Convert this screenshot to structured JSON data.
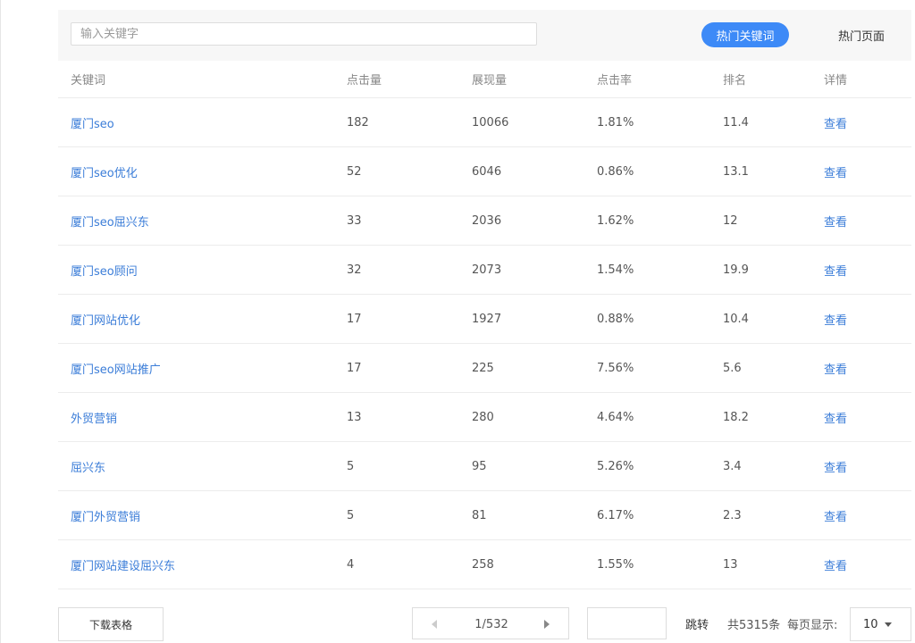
{
  "search": {
    "placeholder": "输入关键字",
    "value": ""
  },
  "tabs": {
    "hot_keywords": "热门关键词",
    "hot_pages": "热门页面"
  },
  "table": {
    "columns": [
      "关键词",
      "点击量",
      "展现量",
      "点击率",
      "排名",
      "详情"
    ],
    "rows": [
      {
        "keyword": "厦门seo",
        "clicks": "182",
        "impressions": "10066",
        "ctr": "1.81%",
        "rank": "11.4",
        "detail": "查看"
      },
      {
        "keyword": "厦门seo优化",
        "clicks": "52",
        "impressions": "6046",
        "ctr": "0.86%",
        "rank": "13.1",
        "detail": "查看"
      },
      {
        "keyword": "厦门seo屈兴东",
        "clicks": "33",
        "impressions": "2036",
        "ctr": "1.62%",
        "rank": "12",
        "detail": "查看"
      },
      {
        "keyword": "厦门seo顾问",
        "clicks": "32",
        "impressions": "2073",
        "ctr": "1.54%",
        "rank": "19.9",
        "detail": "查看"
      },
      {
        "keyword": "厦门网站优化",
        "clicks": "17",
        "impressions": "1927",
        "ctr": "0.88%",
        "rank": "10.4",
        "detail": "查看"
      },
      {
        "keyword": "厦门seo网站推广",
        "clicks": "17",
        "impressions": "225",
        "ctr": "7.56%",
        "rank": "5.6",
        "detail": "查看"
      },
      {
        "keyword": "外贸营销",
        "clicks": "13",
        "impressions": "280",
        "ctr": "4.64%",
        "rank": "18.2",
        "detail": "查看"
      },
      {
        "keyword": "屈兴东",
        "clicks": "5",
        "impressions": "95",
        "ctr": "5.26%",
        "rank": "3.4",
        "detail": "查看"
      },
      {
        "keyword": "厦门外贸营销",
        "clicks": "5",
        "impressions": "81",
        "ctr": "6.17%",
        "rank": "2.3",
        "detail": "查看"
      },
      {
        "keyword": "厦门网站建设屈兴东",
        "clicks": "4",
        "impressions": "258",
        "ctr": "1.55%",
        "rank": "13",
        "detail": "查看"
      }
    ]
  },
  "footer": {
    "download_label": "下载表格",
    "page_indicator": "1/532",
    "jump_value": "",
    "jump_label": "跳转",
    "total_label": "共5315条",
    "per_page_label": "每页显示:",
    "per_page_value": "10"
  },
  "colors": {
    "accent": "#3d8af7",
    "link": "#3b7dd8",
    "toolbar_bg": "#f7f7f7"
  },
  "icons": {
    "prev": "chevron-left-icon",
    "next": "chevron-right-icon",
    "dropdown": "caret-down-icon"
  }
}
